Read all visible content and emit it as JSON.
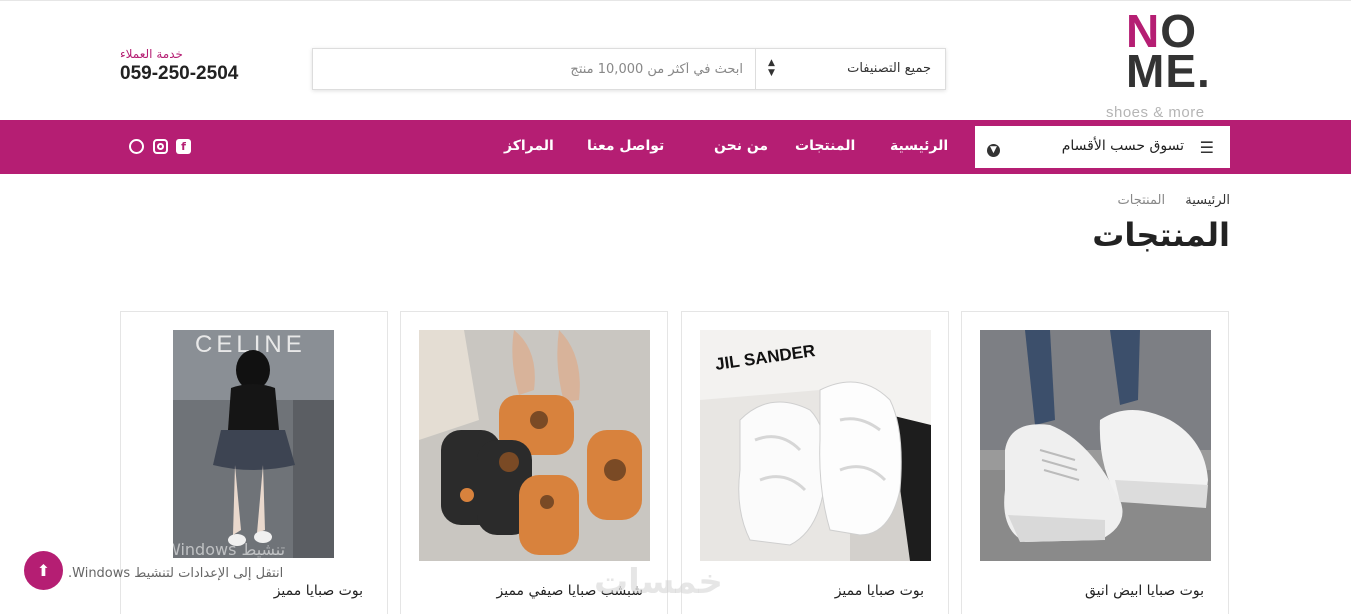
{
  "brand": {
    "logo_text": "NO ME.",
    "logo_n": "N",
    "logo_o": "O",
    "logo_me": "ME.",
    "tagline": "shoes & more",
    "accent_color": "#b51e73"
  },
  "search": {
    "category_selected": "جميع التصنيفات",
    "placeholder": "ابحث في أكثر من 10,000 منتج"
  },
  "support": {
    "label": "خدمة العملاء",
    "phone": "059-250-2504"
  },
  "nav": {
    "shop_by_category": "تسوق حسب الأقسام",
    "links": [
      "الرئيسية",
      "المنتجات",
      "من نحن",
      "تواصل معنا",
      "المراكز"
    ],
    "social_icons": [
      "facebook-icon",
      "instagram-icon",
      "whatsapp-icon"
    ]
  },
  "breadcrumb": {
    "home": "الرئيسية",
    "current": "المنتجات"
  },
  "page_title": "المنتجات",
  "products": [
    {
      "name": "بوت صبايا ابيض انيق",
      "image": "white-platform-sneakers-photo"
    },
    {
      "name": "بوت صبايا مميز",
      "image": "white-chunky-sneakers-box-photo"
    },
    {
      "name": "شبشب صبايا صيفي مميز",
      "image": "slippers-photo"
    },
    {
      "name": "بوت صبايا مميز",
      "image": "girl-outfit-photo"
    }
  ],
  "image_text": {
    "box_brand": "JIL SANDER",
    "store_sign": "CELINE"
  },
  "windows_activation": {
    "title": "Windows تنشيط",
    "text": "انتقل إلى الإعدادات لتنشيط Windows."
  },
  "site_watermark": "خمسات"
}
